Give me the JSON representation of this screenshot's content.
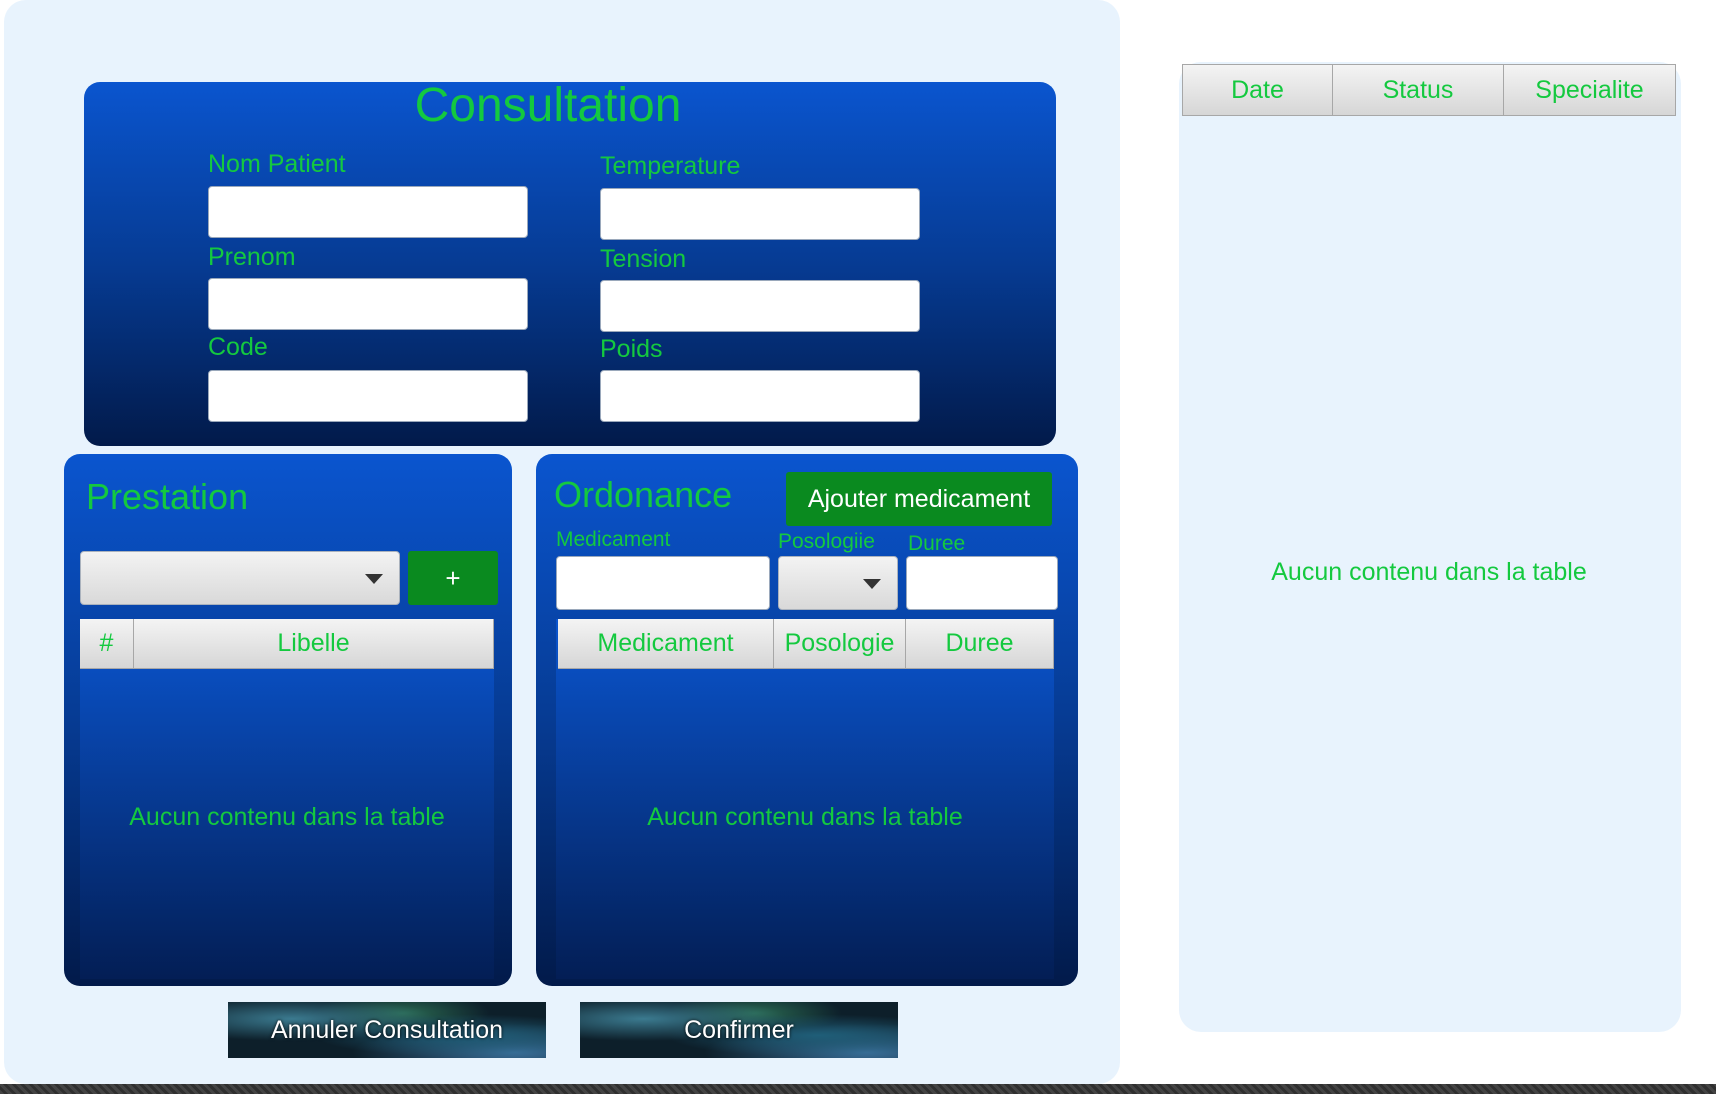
{
  "consultation": {
    "title": "Consultation",
    "fields": {
      "nom_patient": {
        "label": "Nom Patient",
        "value": ""
      },
      "prenom": {
        "label": "Prenom",
        "value": ""
      },
      "code": {
        "label": "Code",
        "value": ""
      },
      "temperature": {
        "label": "Temperature",
        "value": ""
      },
      "tension": {
        "label": "Tension",
        "value": ""
      },
      "poids": {
        "label": "Poids",
        "value": ""
      }
    }
  },
  "prestation": {
    "title": "Prestation",
    "add_label": "+",
    "select_value": "",
    "table": {
      "columns": [
        "#",
        "Libelle"
      ],
      "empty_text": "Aucun contenu dans la table"
    }
  },
  "ordonance": {
    "title": "Ordonance",
    "add_button": "Ajouter medicament",
    "medicament": {
      "label": "Medicament",
      "value": ""
    },
    "posologie": {
      "label": "Posologiie",
      "value": ""
    },
    "duree": {
      "label": "Duree",
      "value": ""
    },
    "table": {
      "columns": [
        "Medicament",
        "Posologie",
        "Duree"
      ],
      "empty_text": "Aucun contenu dans la table"
    }
  },
  "history": {
    "table": {
      "columns": [
        "Date",
        "Status",
        "Specialite"
      ],
      "empty_text": "Aucun contenu dans la table"
    }
  },
  "actions": {
    "cancel": "Annuler Consultation",
    "confirm": "Confirmer"
  },
  "colors": {
    "accent_text": "#14c93f",
    "card_blue": "#0a55cf",
    "panel_bg": "#e8f3fd",
    "button_green": "#0a8a1f"
  }
}
